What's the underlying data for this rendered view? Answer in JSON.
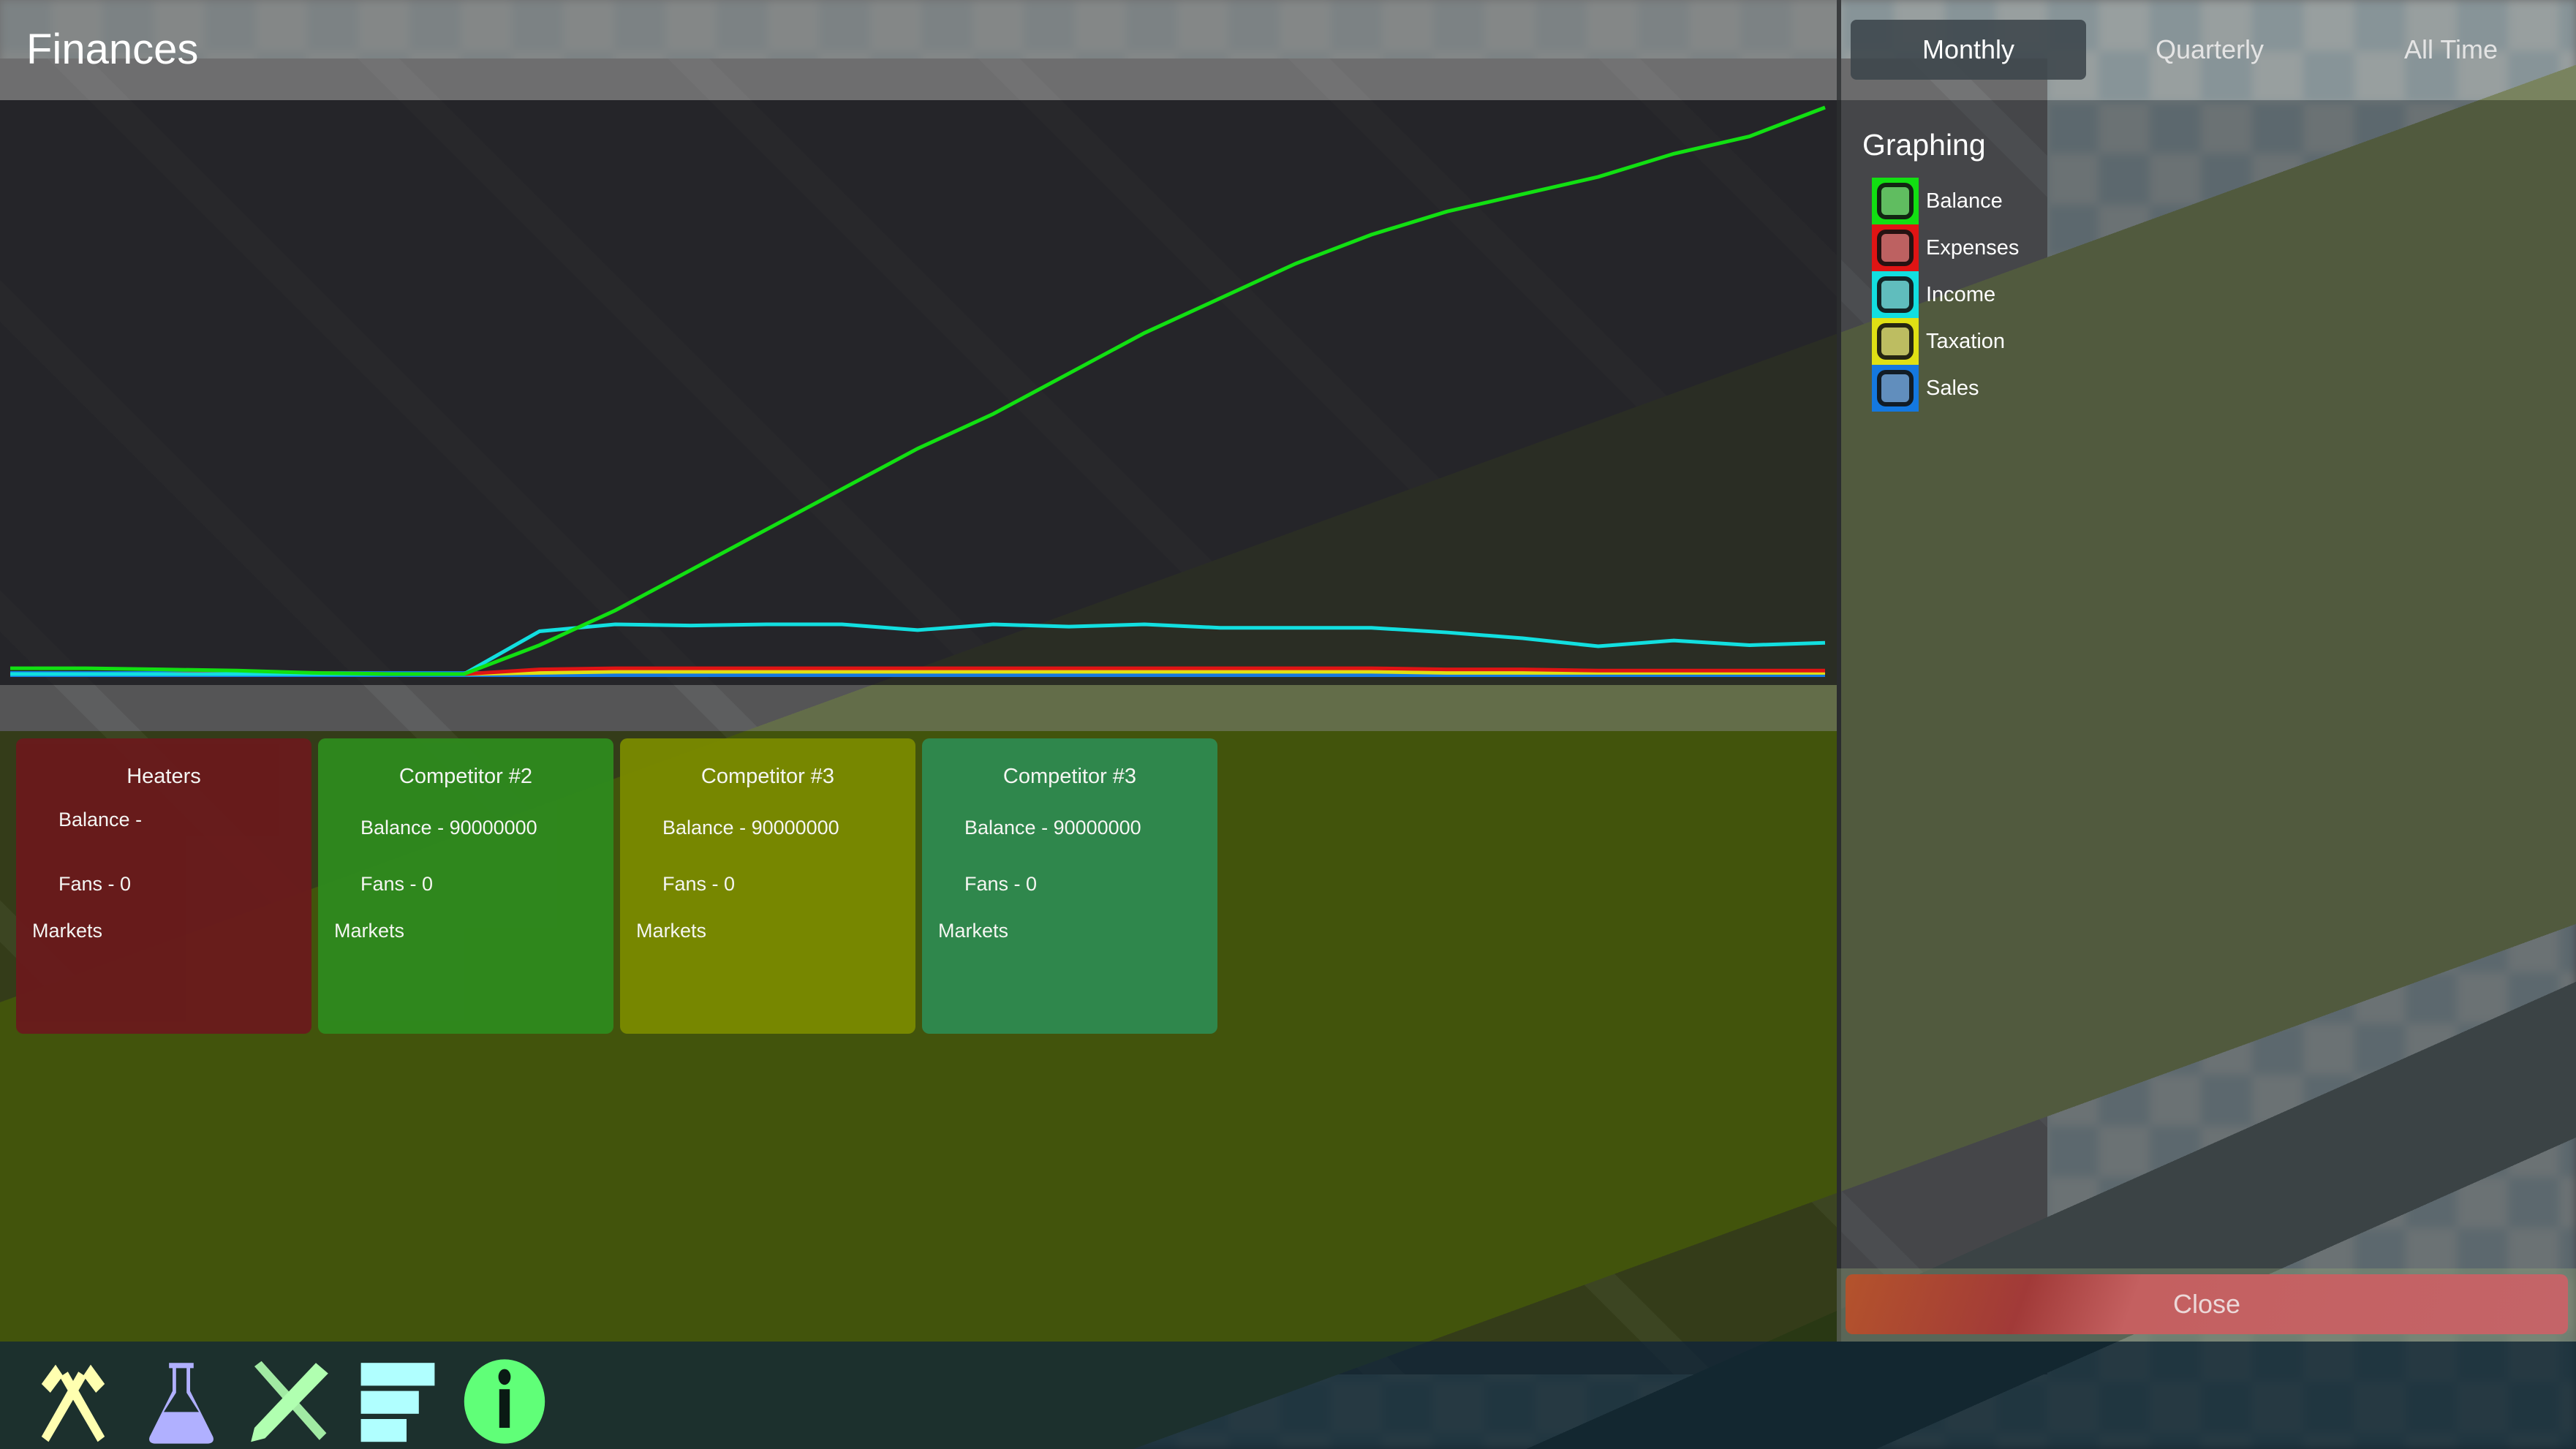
{
  "window": {
    "title": "Finances"
  },
  "tabs": [
    {
      "label": "Monthly",
      "active": true
    },
    {
      "label": "Quarterly",
      "active": false
    },
    {
      "label": "All Time",
      "active": false
    }
  ],
  "graphing": {
    "title": "Graphing",
    "legend": [
      {
        "label": "Balance",
        "color": "#12e012"
      },
      {
        "label": "Expenses",
        "color": "#e01414"
      },
      {
        "label": "Income",
        "color": "#12dfe0"
      },
      {
        "label": "Taxation",
        "color": "#e0e014"
      },
      {
        "label": "Sales",
        "color": "#1478e0"
      }
    ]
  },
  "chart_data": {
    "type": "line",
    "title": "",
    "xlabel": "",
    "ylabel": "",
    "grid": false,
    "legend_position": "right-panel",
    "x": [
      0,
      1,
      2,
      3,
      4,
      5,
      6,
      7,
      8,
      9,
      10,
      11,
      12,
      13,
      14,
      15,
      16,
      17,
      18,
      19,
      20,
      21,
      22,
      23,
      24
    ],
    "ylim": [
      0,
      350
    ],
    "series": [
      {
        "name": "Balance",
        "color": "#12e012",
        "values": [
          5,
          5,
          4,
          3,
          1,
          0,
          0,
          25,
          55,
          90,
          125,
          160,
          195,
          225,
          260,
          295,
          325,
          355,
          380,
          400,
          415,
          430,
          450,
          465,
          490
        ]
      },
      {
        "name": "Expenses",
        "color": "#e01414",
        "values": [
          0,
          0,
          0,
          1,
          1,
          0,
          0,
          4,
          5,
          5,
          5,
          5,
          5,
          5,
          5,
          5,
          5,
          5,
          5,
          4,
          4,
          3,
          3,
          3,
          3
        ]
      },
      {
        "name": "Income",
        "color": "#12dfe0",
        "values": [
          0,
          0,
          0,
          0,
          0,
          0,
          0,
          37,
          43,
          42,
          43,
          43,
          38,
          43,
          41,
          43,
          40,
          40,
          40,
          36,
          31,
          24,
          29,
          25,
          27
        ]
      },
      {
        "name": "Taxation",
        "color": "#e0e014",
        "values": [
          0,
          0,
          0,
          0,
          0,
          0,
          0,
          1,
          2,
          2,
          2,
          2,
          2,
          2,
          2,
          2,
          2,
          2,
          2,
          1,
          1,
          1,
          1,
          1,
          1
        ]
      },
      {
        "name": "Sales",
        "color": "#1478e0",
        "values": [
          0,
          0,
          0,
          0,
          0,
          0,
          0,
          0,
          0,
          0,
          0,
          0,
          0,
          0,
          0,
          0,
          0,
          0,
          0,
          0,
          0,
          0,
          0,
          0,
          0
        ]
      }
    ]
  },
  "companies": [
    {
      "name": "Heaters",
      "balance": "Balance -",
      "fans": "Fans - 0",
      "markets": "Markets",
      "color": "#6a1a1c"
    },
    {
      "name": "Competitor #2",
      "balance": "Balance - 90000000",
      "fans": "Fans - 0",
      "markets": "Markets",
      "color": "#2e8a1e"
    },
    {
      "name": "Competitor #3",
      "balance": "Balance - 90000000",
      "fans": "Fans - 0",
      "markets": "Markets",
      "color": "#7a8a00"
    },
    {
      "name": "Competitor #3",
      "balance": "Balance - 90000000",
      "fans": "Fans - 0",
      "markets": "Markets",
      "color": "#2e8a50"
    }
  ],
  "close_label": "Close",
  "toolbar": [
    {
      "icon": "crossed-hammers-icon",
      "color": "#ffffb0"
    },
    {
      "icon": "flask-icon",
      "color": "#b0b0ff"
    },
    {
      "icon": "ruler-pencil-icon",
      "color": "#b0ffb0"
    },
    {
      "icon": "list-bars-icon",
      "color": "#b0ffff"
    },
    {
      "icon": "info-icon",
      "color": "#60ff78"
    }
  ]
}
